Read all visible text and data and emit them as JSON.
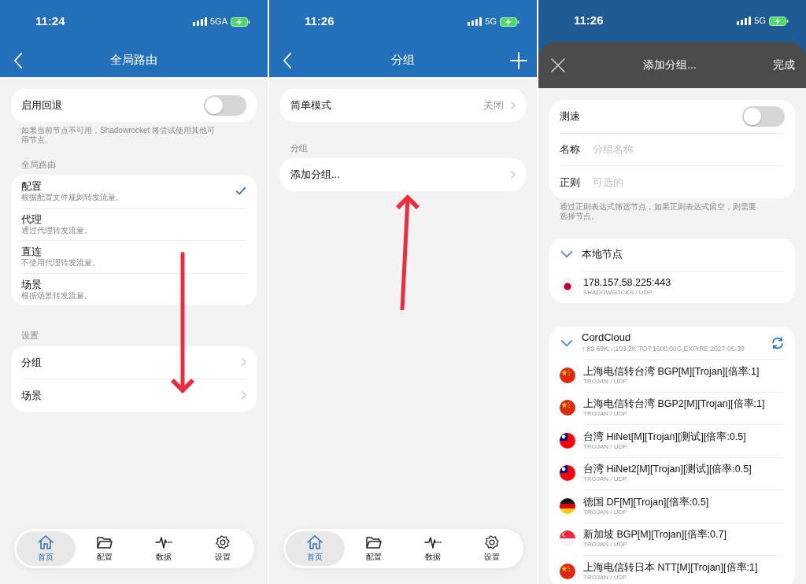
{
  "screens": [
    {
      "kind": "global_routing",
      "status_bar": {
        "time": "11:24",
        "network": "5GA"
      },
      "header": {
        "title": "全局路由",
        "back": true,
        "add": false
      },
      "fallback": {
        "label": "启用回退",
        "on": false
      },
      "fallback_note": "如果当前节点不可用，Shadowrocket 将尝试使用其他可用节点。",
      "routing_label": "全局路由",
      "routing_modes": [
        {
          "title": "配置",
          "description": "根据配置文件规则转发流量。",
          "selected": true
        },
        {
          "title": "代理",
          "description": "通过代理转发流量。",
          "selected": false
        },
        {
          "title": "直连",
          "description": "不使用代理转发流量。",
          "selected": false
        },
        {
          "title": "场景",
          "description": "根据场景转发流量。",
          "selected": false
        }
      ],
      "settings_label": "设置",
      "settings_items": [
        {
          "label": "分组"
        },
        {
          "label": "场景"
        }
      ],
      "annotation_arrow": {
        "kind": "down"
      },
      "tab_bar": [
        {
          "label": "首页",
          "kind": "home",
          "selected": true
        },
        {
          "label": "配置",
          "kind": "folder",
          "selected": false
        },
        {
          "label": "数据",
          "kind": "pulse",
          "selected": false
        },
        {
          "label": "设置",
          "kind": "gear",
          "selected": false
        }
      ]
    },
    {
      "kind": "groups",
      "status_bar": {
        "time": "11:26",
        "network": "5G"
      },
      "header": {
        "title": "分组",
        "back": true,
        "add": true
      },
      "simple_mode": {
        "label": "简单模式",
        "value": "关闭"
      },
      "groups_label": "分组",
      "group_items": [
        {
          "label": "添加分组..."
        }
      ],
      "annotation_arrow": {
        "kind": "up"
      },
      "tab_bar": [
        {
          "label": "首页",
          "kind": "home",
          "selected": true
        },
        {
          "label": "配置",
          "kind": "folder",
          "selected": false
        },
        {
          "label": "数据",
          "kind": "pulse",
          "selected": false
        },
        {
          "label": "设置",
          "kind": "gear",
          "selected": false
        }
      ]
    },
    {
      "kind": "add_group",
      "status_bar": {
        "time": "11:26",
        "network": "5G"
      },
      "sheet_header": {
        "title": "添加分组...",
        "done": "完成"
      },
      "speed_test": {
        "label": "测速",
        "on": false
      },
      "name_field": {
        "label": "名称",
        "placeholder": "分组名称"
      },
      "regex_field": {
        "label": "正则",
        "placeholder": "可选的"
      },
      "form_note": "通过正则表达式筛选节点，如果正则表达式留空，则需要选择节点。",
      "node_sections": [
        {
          "title": "本地节点",
          "expanded": true,
          "refreshable": false,
          "nodes": [
            {
              "name": "178.157.58.225:443",
              "protocol": "SHADOWSOCKS / UDP",
              "kind": "jp"
            }
          ]
        },
        {
          "title": "CordCloud",
          "subscription_info": "↑:89.69K,↓:103.2K,TOT:1600.00G,EXPIRE:2027-05-30",
          "expanded": true,
          "refreshable": true,
          "nodes": [
            {
              "name": "上海电信转台湾 BGP[M][Trojan][倍率:1]",
              "protocol": "TROJAN / UDP",
              "kind": "cn"
            },
            {
              "name": "上海电信转台湾 BGP2[M][Trojan][倍率:1]",
              "protocol": "TROJAN / UDP",
              "kind": "cn"
            },
            {
              "name": "台湾 HiNet[M][Trojan][测试][倍率:0.5]",
              "protocol": "TROJAN / UDP",
              "kind": "tw"
            },
            {
              "name": "台湾 HiNet2[M][Trojan][测试][倍率:0.5]",
              "protocol": "TROJAN / UDP",
              "kind": "tw"
            },
            {
              "name": "德国 DF[M][Trojan][倍率:0.5]",
              "protocol": "TROJAN / UDP",
              "kind": "de"
            },
            {
              "name": "新加坡 BGP[M][Trojan][倍率:0.7]",
              "protocol": "TROJAN / UDP",
              "kind": "sg"
            },
            {
              "name": "上海电信转日本 NTT[M][Trojan][倍率:1]",
              "protocol": "TROJAN / UDP",
              "kind": "cn"
            }
          ]
        }
      ]
    }
  ]
}
